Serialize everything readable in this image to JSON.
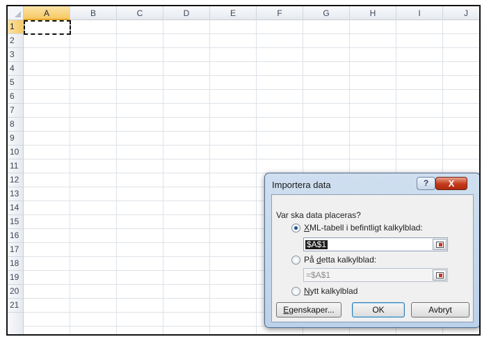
{
  "columns": [
    "A",
    "B",
    "C",
    "D",
    "E",
    "F",
    "G",
    "H",
    "I",
    "J"
  ],
  "rows": [
    "1",
    "2",
    "3",
    "4",
    "5",
    "6",
    "7",
    "8",
    "9",
    "10",
    "11",
    "12",
    "13",
    "14",
    "15",
    "16",
    "17",
    "18",
    "19",
    "20",
    "21"
  ],
  "dialog": {
    "title": "Importera data",
    "help_label": "?",
    "close_label": "X",
    "question": "Var ska data placeras?",
    "option_xml": {
      "accel": "X",
      "rest": "ML-tabell i befintligt kalkylblad:"
    },
    "xml_ref_value": "$A$1",
    "option_sheet": {
      "before": "På ",
      "accel": "d",
      "rest": "etta kalkylblad:"
    },
    "sheet_ref_value": "=$A$1",
    "option_new": {
      "accel": "N",
      "rest": "ytt kalkylblad"
    },
    "properties": {
      "accel": "E",
      "rest": "genskaper..."
    },
    "ok_label": "OK",
    "cancel_label": "Avbryt"
  }
}
